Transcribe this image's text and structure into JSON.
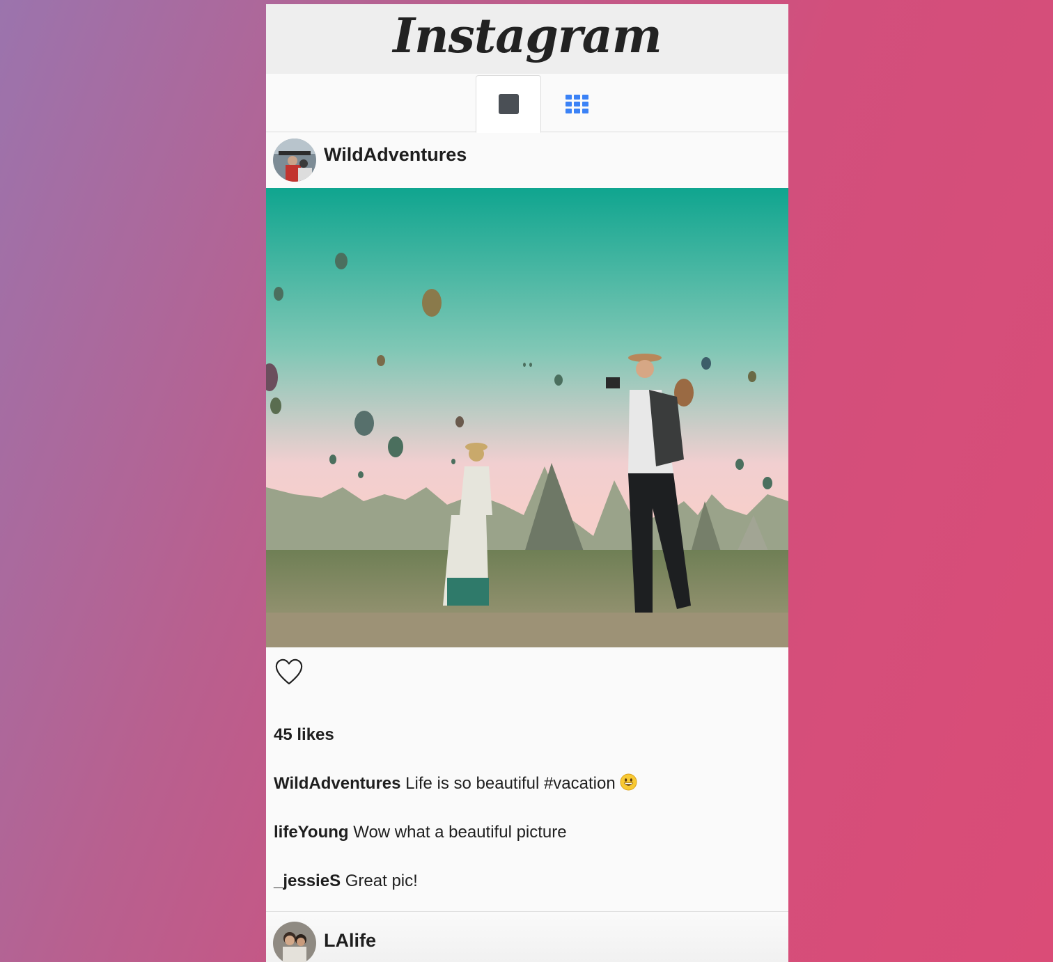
{
  "header": {
    "logo_text": "Instagram"
  },
  "tabs": [
    {
      "name": "single-view",
      "icon": "square-icon",
      "active": true
    },
    {
      "name": "grid-view",
      "icon": "grid-icon",
      "active": false,
      "color": "#3b82f6"
    }
  ],
  "post": {
    "username": "WildAdventures",
    "likes": "45 likes",
    "caption": {
      "user": "WildAdventures",
      "text": "Life is so beautiful #vacation",
      "emoji": "grinning-face-emoji"
    },
    "comments": [
      {
        "user": "lifeYoung",
        "text": "Wow what a beautiful picture"
      },
      {
        "user": "_jessieS",
        "text": "Great pic!"
      }
    ]
  },
  "next_post": {
    "username": "LAlife"
  }
}
